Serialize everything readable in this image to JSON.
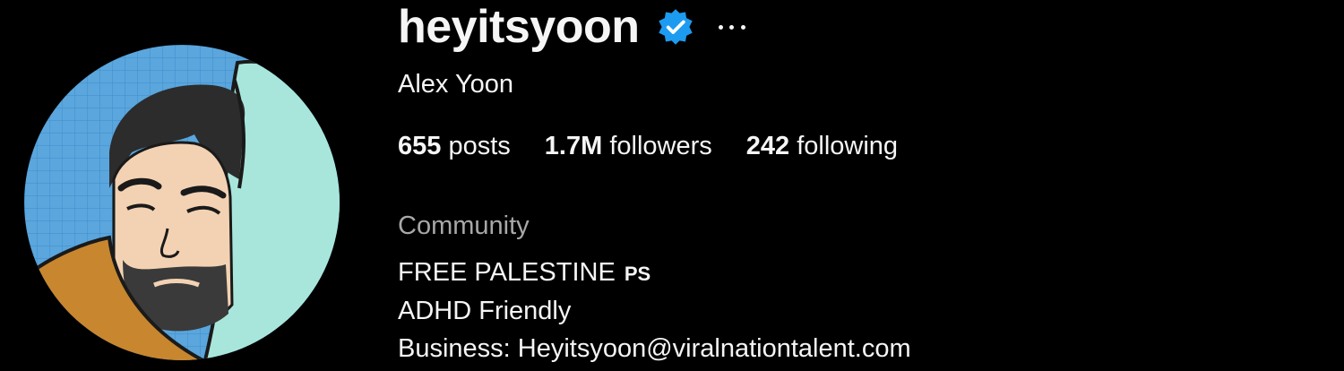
{
  "profile": {
    "username": "heyitsyoon",
    "full_name": "Alex Yoon",
    "verified": true,
    "stats": [
      {
        "value": "655",
        "label": "posts"
      },
      {
        "value": "1.7M",
        "label": "followers"
      },
      {
        "value": "242",
        "label": "following"
      }
    ],
    "category": "Community",
    "bio": {
      "line1": "FREE PALESTINE",
      "line1_flag": "PS",
      "line2": "ADHD Friendly",
      "line3": "Business: Heyitsyoon@viralnationtalent.com"
    }
  },
  "icons": {
    "verified": "verified-badge-icon",
    "more": "more-options-icon"
  },
  "colors": {
    "background": "#000000",
    "text": "#f5f5f5",
    "muted": "#a8a8a8",
    "verified_blue": "#1d9bf0"
  }
}
